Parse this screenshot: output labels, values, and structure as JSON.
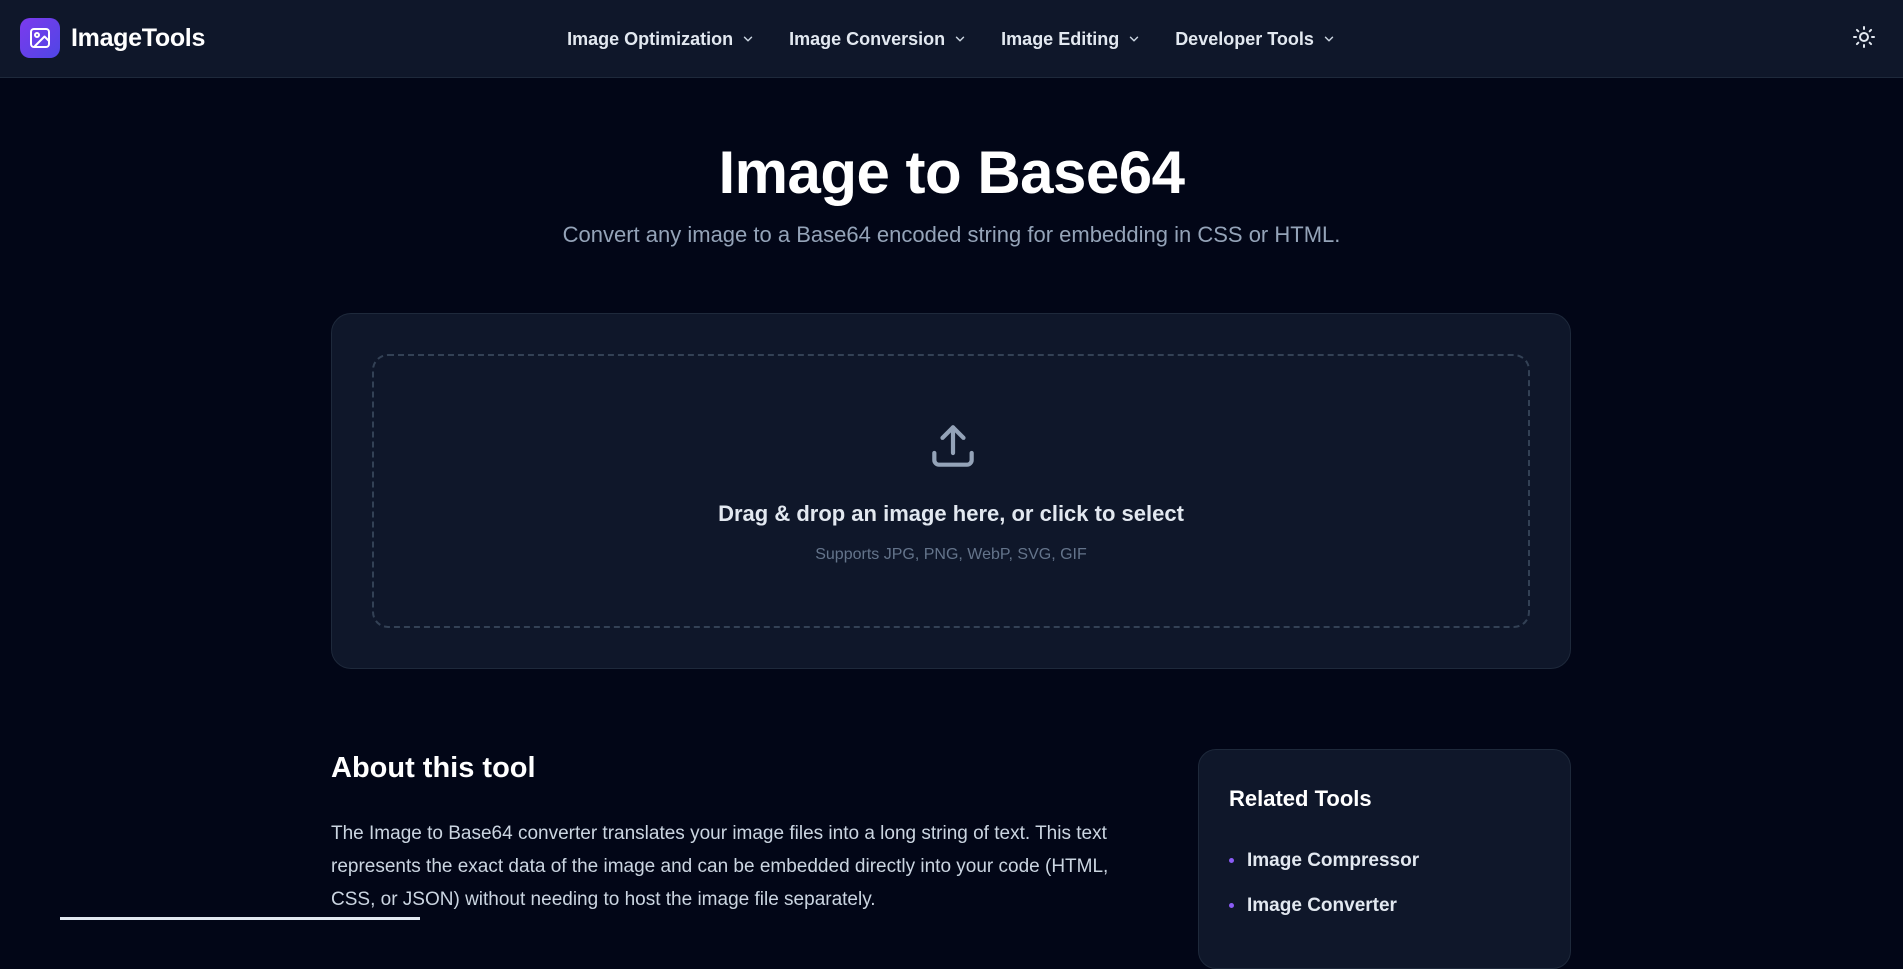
{
  "brand": {
    "name": "ImageTools",
    "accent_color": "#6d28d9",
    "logo_icon": "image-icon"
  },
  "nav": {
    "items": [
      {
        "label": "Image Optimization",
        "icon": "chevron-down-icon"
      },
      {
        "label": "Image Conversion",
        "icon": "chevron-down-icon"
      },
      {
        "label": "Image Editing",
        "icon": "chevron-down-icon"
      },
      {
        "label": "Developer Tools",
        "icon": "chevron-down-icon"
      }
    ],
    "theme_toggle_icon": "sun-icon"
  },
  "hero": {
    "title": "Image to Base64",
    "subtitle": "Convert any image to a Base64 encoded string for embedding in CSS or HTML."
  },
  "upload": {
    "icon": "upload-icon",
    "title": "Drag & drop an image here, or click to select",
    "hint": "Supports JPG, PNG, WebP, SVG, GIF"
  },
  "about": {
    "title": "About this tool",
    "text": "The Image to Base64 converter translates your image files into a long string of text. This text represents the exact data of the image and can be embedded directly into your code (HTML, CSS, or JSON) without needing to host the image file separately."
  },
  "related": {
    "title": "Related Tools",
    "items": [
      {
        "label": "Image Compressor"
      },
      {
        "label": "Image Converter"
      }
    ]
  },
  "colors": {
    "page_bg": "#020617",
    "header_bg": "#0f172a",
    "card_bg": "#0f172a",
    "muted_text": "#94a3b8",
    "bullet": "#8b5cf6"
  }
}
